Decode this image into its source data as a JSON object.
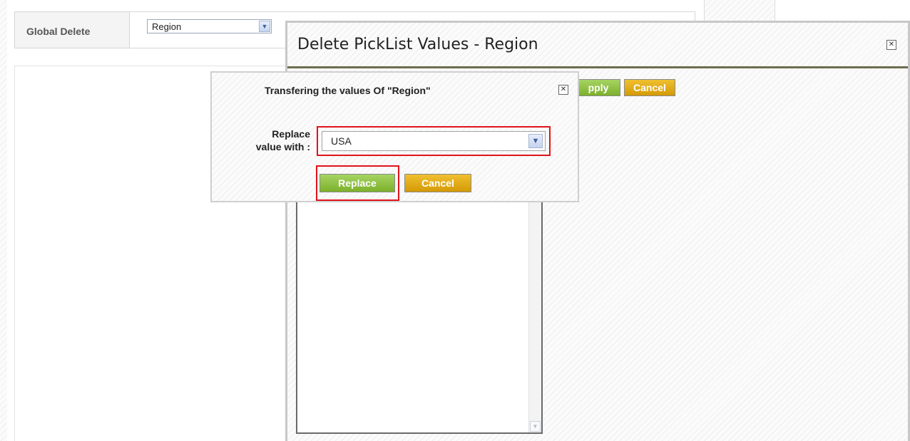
{
  "toolbar": {
    "label": "Global Delete",
    "select_value": "Region"
  },
  "main_dialog": {
    "title": "Delete PickList Values - Region",
    "apply_label": "pply",
    "cancel_label": "Cancel"
  },
  "transfer_dialog": {
    "title": "Transfering the values Of \"Region\"",
    "replace_label_line1": "Replace",
    "replace_label_line2": "value with :",
    "selected_value": "USA",
    "replace_button": "Replace",
    "cancel_button": "Cancel"
  },
  "colors": {
    "button_green": "#8cc63e",
    "button_orange": "#e0a812",
    "highlight_red": "#e0141a",
    "title_divider": "#6b6d4e"
  },
  "icons": {
    "close": "close-icon",
    "dropdown": "chevron-down-icon"
  }
}
